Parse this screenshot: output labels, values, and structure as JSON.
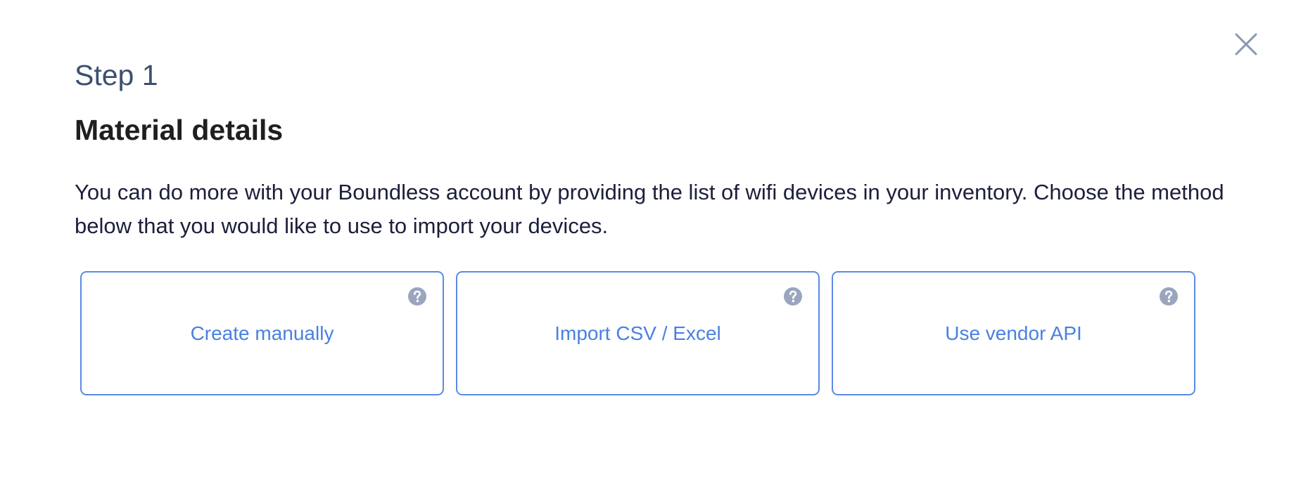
{
  "modal": {
    "step": "Step 1",
    "title": "Material details",
    "description": "You can do more with your Boundless account by providing the list of wifi devices in your inventory. Choose the method below that you would like to use to import your devices.",
    "close_icon": "close-icon"
  },
  "options": [
    {
      "label": "Create manually",
      "help_icon": "help-icon"
    },
    {
      "label": "Import CSV / Excel",
      "help_icon": "help-icon"
    },
    {
      "label": "Use vendor API",
      "help_icon": "help-icon"
    }
  ],
  "colors": {
    "accent": "#4a80e0",
    "card_border": "#5b8ae6",
    "step_text": "#3c4f70",
    "title_text": "#1f1f1f",
    "body_text": "#1c1f3a",
    "icon_gray": "#9aa5be"
  }
}
